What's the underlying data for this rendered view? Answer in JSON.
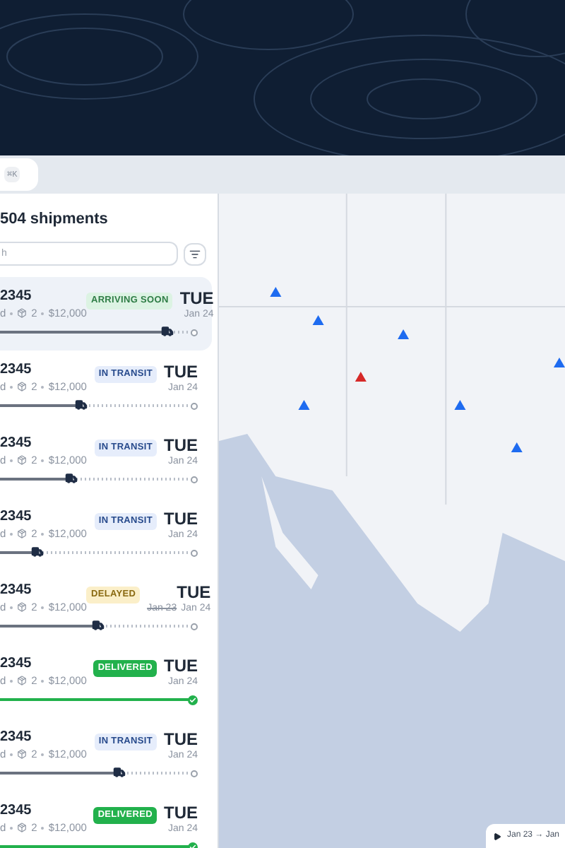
{
  "command_hint": {
    "shortcut": "⌘K"
  },
  "panel": {
    "title": "504 shipments",
    "search": {
      "placeholder": "h"
    }
  },
  "shipments": [
    {
      "id": "2345",
      "origin": "d",
      "packages": "2",
      "value": "$12,000",
      "status": {
        "kind": "arriving",
        "label": "ARRIVING SOON"
      },
      "day": "TUE",
      "date": "Jan 24",
      "level": 0.88,
      "selected": true
    },
    {
      "id": "2345",
      "origin": "d",
      "packages": "2",
      "value": "$12,000",
      "status": {
        "kind": "transit",
        "label": "IN TRANSIT"
      },
      "day": "TUE",
      "date": "Jan 24",
      "level": 0.43,
      "selected": false
    },
    {
      "id": "2345",
      "origin": "d",
      "packages": "2",
      "value": "$12,000",
      "status": {
        "kind": "transit",
        "label": "IN TRANSIT"
      },
      "day": "TUE",
      "date": "Jan 24",
      "level": 0.38,
      "selected": false
    },
    {
      "id": "2345",
      "origin": "d",
      "packages": "2",
      "value": "$12,000",
      "status": {
        "kind": "transit",
        "label": "IN TRANSIT"
      },
      "day": "TUE",
      "date": "Jan 24",
      "level": 0.2,
      "selected": false
    },
    {
      "id": "2345",
      "origin": "d",
      "packages": "2",
      "value": "$12,000",
      "status": {
        "kind": "delayed",
        "label": "DELAYED"
      },
      "day": "TUE",
      "old_date": "Jan 23",
      "date": "Jan 24",
      "level": 0.52,
      "selected": false
    },
    {
      "id": "2345",
      "origin": "d",
      "packages": "2",
      "value": "$12,000",
      "status": {
        "kind": "delivered",
        "label": "DELIVERED"
      },
      "day": "TUE",
      "date": "Jan 24",
      "level": 1,
      "selected": false
    },
    {
      "id": "2345",
      "origin": "d",
      "packages": "2",
      "value": "$12,000",
      "status": {
        "kind": "transit",
        "label": "IN TRANSIT"
      },
      "day": "TUE",
      "date": "Jan 24",
      "level": 0.63,
      "selected": false
    },
    {
      "id": "2345",
      "origin": "d",
      "packages": "2",
      "value": "$12,000",
      "status": {
        "kind": "delivered",
        "label": "DELIVERED"
      },
      "day": "TUE",
      "date": "Jan 24",
      "level": 1,
      "selected": false
    }
  ],
  "map": {
    "timeline": {
      "range": "Jan 23 → Jan"
    }
  }
}
